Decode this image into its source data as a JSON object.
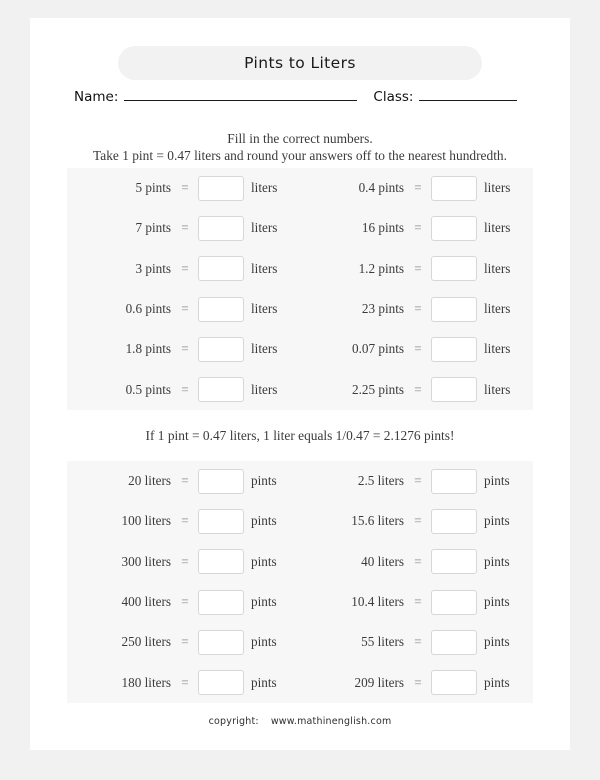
{
  "worksheet": {
    "title": "Pints to Liters",
    "name_label": "Name:",
    "class_label": "Class:",
    "instruction_line_1": "Fill in the correct numbers.",
    "instruction_line_2": "Take 1 pint = 0.47 liters and round your answers off to the nearest hundredth.",
    "middle_note": "If 1 pint = 0.47 liters, 1 liter equals 1/0.47 = 2.1276 pints!",
    "equals_sign": "=",
    "answer_placeholder": "",
    "colors": {
      "page_background": "#f1f1f1",
      "paper": "#ffffff",
      "panel": "#f7f7f7",
      "title_pill": "#f2f2f2",
      "box_border": "#d7d7d7",
      "text": "#3b3b3b"
    }
  },
  "section_pints_to_liters": {
    "from_unit": "pints",
    "to_unit": "liters",
    "rows": [
      {
        "left": {
          "value": "5 pints",
          "answer": ""
        },
        "right": {
          "value": "0.4 pints",
          "answer": ""
        }
      },
      {
        "left": {
          "value": "7 pints",
          "answer": ""
        },
        "right": {
          "value": "16 pints",
          "answer": ""
        }
      },
      {
        "left": {
          "value": "3 pints",
          "answer": ""
        },
        "right": {
          "value": "1.2 pints",
          "answer": ""
        }
      },
      {
        "left": {
          "value": "0.6 pints",
          "answer": ""
        },
        "right": {
          "value": "23 pints",
          "answer": ""
        }
      },
      {
        "left": {
          "value": "1.8 pints",
          "answer": ""
        },
        "right": {
          "value": "0.07 pints",
          "answer": ""
        }
      },
      {
        "left": {
          "value": "0.5 pints",
          "answer": ""
        },
        "right": {
          "value": "2.25 pints",
          "answer": ""
        }
      }
    ]
  },
  "section_liters_to_pints": {
    "from_unit": "liters",
    "to_unit": "pints",
    "rows": [
      {
        "left": {
          "value": "20 liters",
          "answer": ""
        },
        "right": {
          "value": "2.5 liters",
          "answer": ""
        }
      },
      {
        "left": {
          "value": "100 liters",
          "answer": ""
        },
        "right": {
          "value": "15.6 liters",
          "answer": ""
        }
      },
      {
        "left": {
          "value": "300 liters",
          "answer": ""
        },
        "right": {
          "value": "40 liters",
          "answer": ""
        }
      },
      {
        "left": {
          "value": "400 liters",
          "answer": ""
        },
        "right": {
          "value": "10.4 liters",
          "answer": ""
        }
      },
      {
        "left": {
          "value": "250 liters",
          "answer": ""
        },
        "right": {
          "value": "55 liters",
          "answer": ""
        }
      },
      {
        "left": {
          "value": "180 liters",
          "answer": ""
        },
        "right": {
          "value": "209 liters",
          "answer": ""
        }
      }
    ]
  },
  "footer": {
    "copyright_label": "copyright:",
    "website": "www.mathinenglish.com"
  }
}
